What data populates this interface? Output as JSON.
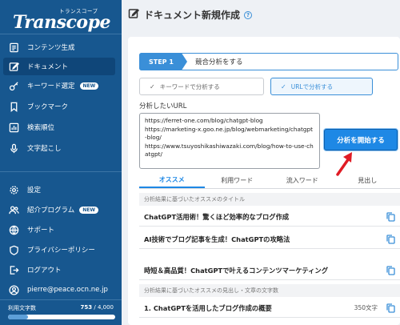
{
  "brand": {
    "name": "Transcope",
    "sub": "トランスコープ"
  },
  "sidebar": {
    "items": [
      {
        "label": "コンテンツ生成",
        "icon": "document-generate-icon"
      },
      {
        "label": "ドキュメント",
        "icon": "edit-icon",
        "active": true
      },
      {
        "label": "キーワード選定",
        "icon": "key-icon",
        "badge": "NEW"
      },
      {
        "label": "ブックマーク",
        "icon": "bookmark-icon"
      },
      {
        "label": "検索順位",
        "icon": "bar-chart-icon"
      },
      {
        "label": "文字起こし",
        "icon": "microphone-icon"
      }
    ],
    "bottom_items": [
      {
        "label": "設定",
        "icon": "gear-icon"
      },
      {
        "label": "紹介プログラム",
        "icon": "users-icon",
        "badge": "NEW"
      },
      {
        "label": "サポート",
        "icon": "globe-icon"
      },
      {
        "label": "プライバシーポリシー",
        "icon": "shield-icon"
      },
      {
        "label": "ログアウト",
        "icon": "logout-icon"
      },
      {
        "label": "pierre@peace.ocn.ne.jp",
        "icon": "user-icon"
      }
    ],
    "usage": {
      "label": "利用文字数",
      "used": "753",
      "total": " / 4,000",
      "fraction": 0.19
    }
  },
  "main": {
    "title": "ドキュメント新規作成",
    "help": "?",
    "step": {
      "tag": "STEP 1",
      "label": "競合分析をする"
    },
    "options": [
      {
        "label": "キーワードで分析する",
        "selected": false
      },
      {
        "label": "URLで分析する",
        "selected": true
      }
    ],
    "url_label": "分析したいURL",
    "url_value": "https://ferret-one.com/blog/chatgpt-blog\nhttps://marketing-x.goo.ne.jp/blog/webmarketing/chatgpt-blog/\nhttps://www.tsuyoshikashiwazaki.com/blog/how-to-use-chatgpt/",
    "start_button": "分析を開始する",
    "tabs": [
      "オススメ",
      "利用ワード",
      "流入ワード",
      "見出し"
    ],
    "section1": "分析結果に基づいたオススメのタイトル",
    "titles": [
      "ChatGPT活用術！驚くほど効率的なブログ作成",
      "AI技術でブログ記事を生成！ChatGPTの攻略法",
      "時短＆高品質！ChatGPTで叶えるコンテンツマーケティング"
    ],
    "section2": "分析結果に基づいたオススメの見出し・文章の文字数",
    "headings": [
      {
        "text": "1. ChatGPTを活用したブログ作成の概要",
        "count": "350文字"
      }
    ]
  },
  "colors": {
    "sidebar": "#17578f",
    "accent": "#1e88e5",
    "arrow": "#e01b24"
  }
}
